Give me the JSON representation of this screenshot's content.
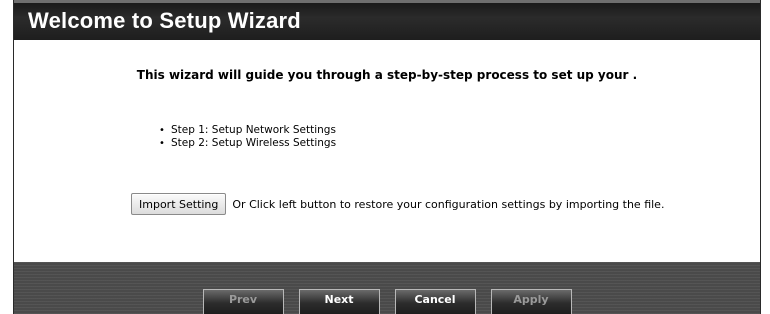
{
  "header": {
    "title": "Welcome to Setup Wizard"
  },
  "intro": "This wizard will guide you through a step-by-step process to set up your .",
  "steps": [
    "Step 1: Setup Network Settings",
    "Step 2: Setup Wireless Settings"
  ],
  "import": {
    "button_label": "Import Setting",
    "description": "Or Click left button to restore your configuration settings by importing the file."
  },
  "footer": {
    "prev_label": "Prev",
    "next_label": "Next",
    "cancel_label": "Cancel",
    "apply_label": "Apply"
  },
  "colors": {
    "title_bar": "#1e1e1e",
    "footer": "#4a4a4a",
    "disabled_text": "#9a9a9a"
  }
}
